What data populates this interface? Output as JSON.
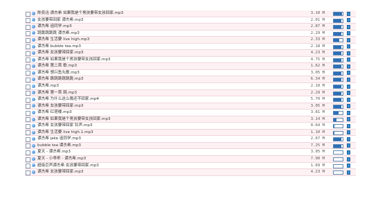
{
  "rows": [
    {
      "name": "陈奕迅 谭杰希 如果我是个男孩要带女孩回家.mp3",
      "size": "3.10 M",
      "level": 0.95,
      "icon": "download-icon"
    },
    {
      "name": "女孩要带回家 谭杰希.mp3",
      "size": "2.01 M",
      "level": 0.85,
      "icon": "download-icon"
    },
    {
      "name": "谭杰希 追同学.mp3",
      "size": "2.87 M",
      "level": 0.85,
      "icon": "download-icon"
    },
    {
      "name": "跳跳跳跳跳 谭杰希.mp3",
      "size": "2.29 M",
      "level": 0.85,
      "icon": "download-icon"
    },
    {
      "name": "谭杰希 生活要 live high.mp3",
      "size": "2.33 M",
      "level": 0.6,
      "icon": "download-icon"
    },
    {
      "name": "谭杰希 bubble tea.mp3",
      "size": "2.18 M",
      "level": 0.85,
      "icon": "download-icon"
    },
    {
      "name": "谭杰希 女孩要带回家.mp3",
      "size": "4.23 M",
      "level": 0.85,
      "icon": "download-icon"
    },
    {
      "name": "谭杰希 如果我是个男孩要带女孩回家.mp3",
      "size": "4.75 M",
      "level": 0.85,
      "icon": "download-icon"
    },
    {
      "name": "谭杰希 第二首 歌.mp3",
      "size": "1.62 M",
      "level": 0.85,
      "icon": "download-icon"
    },
    {
      "name": "谭杰希 想兴鱼丸歌.mp3",
      "size": "3.05 M",
      "level": 0.85,
      "icon": "download-icon"
    },
    {
      "name": "谭杰希 跳跳跳跳跳跳.mp3",
      "size": "6.34 M",
      "level": 0.85,
      "icon": "download-icon"
    },
    {
      "name": "谭杰希.mp3",
      "size": "2.10 M",
      "level": 0.85,
      "icon": "download-icon"
    },
    {
      "name": "谭杰希 第一首 跳.mp3",
      "size": "2.29 M",
      "level": 0.85,
      "icon": "download-icon"
    },
    {
      "name": "谭杰希 为什么这么晚还不回家.mp4",
      "size": "5.70 M",
      "level": 0.85,
      "icon": "download-icon"
    },
    {
      "name": "谭杰希 女孩要带回家.mp3",
      "size": "3.05 M",
      "level": 0.85,
      "icon": "download-icon"
    },
    {
      "name": "谭杰希 红塔楼.mp3",
      "size": "3.81 M",
      "level": 0.55,
      "icon": "download-icon"
    },
    {
      "name": "谭杰希 如果我是个男孩要带女孩回家.mp3",
      "size": "3.14 M",
      "level": 0.3,
      "icon": "download-icon"
    },
    {
      "name": "谭杰希 女孩要带回家 铃声.mp3",
      "size": "0.64 M",
      "level": 0.1,
      "icon": "download-icon"
    },
    {
      "name": "谭杰希 生活要 live high.1.mp3",
      "size": "1.10 M",
      "level": 0.1,
      "icon": "download-icon"
    },
    {
      "name": "谭杰希 jake 追同学.mp3",
      "size": "2.67 M",
      "level": 0.85,
      "icon": "download-icon"
    },
    {
      "name": "bubble tea 谭杰希.mp3",
      "size": "7.25 M",
      "level": 0.85,
      "icon": "download-icon"
    },
    {
      "name": "夏天 - 谭杰希.mp3",
      "size": "3.05 M",
      "level": 0.0,
      "icon": "download-icon"
    },
    {
      "name": "夏天 - 小乖乖 - 谭杰希.mp3",
      "size": "7.90 M",
      "level": 0.0,
      "icon": "download-icon"
    },
    {
      "name": "超级巨声谭杰希 女孩要带回家.mp3",
      "size": "1.69 M",
      "level": 0.0,
      "icon": "download-icon"
    },
    {
      "name": "谭杰希 女孩要带回家.mp3",
      "size": "4.23 M",
      "level": 0.0,
      "icon": "download-icon"
    }
  ]
}
